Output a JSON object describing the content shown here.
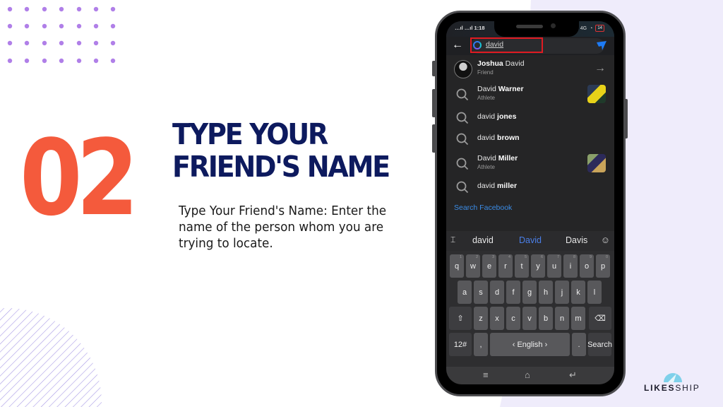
{
  "slide": {
    "step_number": "02",
    "title_line1": "TYPE YOUR",
    "title_line2": "FRIEND'S NAME",
    "description": "Type Your Friend's Name: Enter the name of the person whom you are trying to locate.",
    "colors": {
      "step_number": "#f45a3c",
      "title": "#0d1a5e",
      "accent_lavender": "#efecfb",
      "dot_purple": "#b07fe8"
    }
  },
  "phone": {
    "status_bar": {
      "signal": "…ıl …ıl",
      "time": "1:18",
      "network": "4G",
      "wifi": "◔",
      "battery": "14"
    },
    "search": {
      "query": "david",
      "back_icon": "arrow-left",
      "messenger_icon": "messenger"
    },
    "results": [
      {
        "type": "friend",
        "first": "Joshua",
        "rest": " David",
        "sub": "Friend",
        "bold_first": true
      },
      {
        "type": "page",
        "first": "David ",
        "rest": "Warner",
        "sub": "Athlete"
      },
      {
        "type": "query",
        "first": "david ",
        "rest": "jones",
        "sub": ""
      },
      {
        "type": "query",
        "first": "david ",
        "rest": "brown",
        "sub": ""
      },
      {
        "type": "page",
        "first": "David ",
        "rest": "Miller",
        "sub": "Athlete"
      },
      {
        "type": "query",
        "first": "david ",
        "rest": "miller",
        "sub": ""
      }
    ],
    "search_facebook_label": "Search Facebook",
    "keyboard": {
      "suggestions": [
        "david",
        "David",
        "Davis"
      ],
      "active_suggestion": 1,
      "row1": [
        "q",
        "w",
        "e",
        "r",
        "t",
        "y",
        "u",
        "i",
        "o",
        "p"
      ],
      "row1_hints": [
        "1",
        "2",
        "3",
        "4",
        "5",
        "6",
        "7",
        "8",
        "9",
        "0"
      ],
      "row2": [
        "a",
        "s",
        "d",
        "f",
        "g",
        "h",
        "j",
        "k",
        "l"
      ],
      "row3": [
        "z",
        "x",
        "c",
        "v",
        "b",
        "n",
        "m"
      ],
      "shift_label": "⇧",
      "backspace_label": "⌫",
      "symbols_label": "12#",
      "comma_label": ",",
      "space_label": "‹ English ›",
      "period_label": ".",
      "search_label": "Search"
    },
    "nav": {
      "menu": "≡",
      "home": "⌂",
      "back": "↵"
    }
  },
  "logo": {
    "bold": "LIKES",
    "light": "SHIP"
  }
}
